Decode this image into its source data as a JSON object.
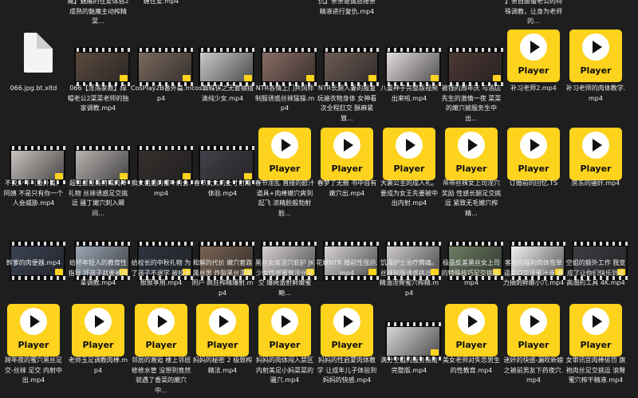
{
  "top_row": [
    {
      "col": 1,
      "label": "魔】魅魔的性爱体验2 成熟的魅魔主动榨精 菜..."
    },
    {
      "col": 2,
      "label": "缠性爱.mp4"
    },
    {
      "col": 5,
      "label": "仇】亲亲是诚恳接亲精液进行复仇.mp4"
    },
    {
      "col": 8,
      "label": "】亲自腰瘦老公的特殊调教，让身为老师的..."
    }
  ],
  "rows": [
    [
      {
        "type": "doc",
        "icon": "document-icon",
        "label": "066.jpg.bt.xltd"
      },
      {
        "type": "film",
        "color": "#5a4a3e",
        "label": "066【淫荡家教】绿帽老公2菜菜老师的独家调教.mp4"
      },
      {
        "type": "film",
        "color": "#7b6a5e",
        "label": "CosPlay2B番外篇.mp4"
      },
      {
        "type": "film",
        "color": "#c9c9c9",
        "label": "cos蜘蛛侠之无套抽插清纯少女.mp4"
      },
      {
        "type": "film",
        "color": "#8a6c64",
        "label": "NTR各情上门共饲师 制服诱惑丝袜猛操.mp4"
      },
      {
        "type": "film",
        "color": "#6d5b55",
        "label": "NTR长腿人妻的报复 玩遍衣物身体 女神看次全程肛交 酥麻紧致..."
      },
      {
        "type": "film",
        "color": "#e3dcdc",
        "label": "八重神子完整版视频出来啦.mp4"
      },
      {
        "type": "film",
        "color": "#4d3835",
        "label": "被钱的周年庆 与酒店先生的激情一夜 菜菜的嫩穴被服务生中出..."
      },
      {
        "type": "player",
        "label": "补习老师2.mp4"
      },
      {
        "type": "player",
        "label": "补习老师的肉体教学.mp4"
      }
    ],
    [
      {
        "type": "film",
        "color": "#c8c2bf",
        "label": "不良少年（番外篇）阿姨 不是只有你一个人会威胁.mp4"
      },
      {
        "type": "film",
        "color": "#b7b3b1",
        "label": "超性感淫荡特辑肉棒礼物 丝袜诱惑足交挑逗 骚丁嫩穴刺入瞬间..."
      },
      {
        "type": "film",
        "color": "#35302e",
        "label": "痴女姐姐的樱叶约会.mp4"
      },
      {
        "type": "film",
        "color": "#43404a",
        "label": "春节太太的止寸射精体验.mp4"
      },
      {
        "type": "player",
        "label": "春节淫乱 直接的慰汁 道具+肉棒嫩穴爽到起飞 浓精脸般勃射脸..."
      },
      {
        "type": "player",
        "label": "春梦了无痕 书中自有嫩穴出.mp4"
      },
      {
        "type": "player",
        "label": "大裹公主的成人礼。要成为女王先要被中出内射.mp4"
      },
      {
        "type": "player",
        "label": "吊带丝袜女上司淫穴奖励 性感长腿足交挑逗 紧致无毛嫩穴榨精..."
      },
      {
        "type": "player",
        "label": "订婚前的回忆.TS"
      },
      {
        "type": "player",
        "label": "房东的骚奸.mp4"
      }
    ],
    [
      {
        "type": "film",
        "color": "#3a4253",
        "label": "幹爹的肉便器.mp4"
      },
      {
        "type": "film",
        "color": "#9aa6b4",
        "label": "给坏年轻人的教育性指导 坏孩子就要被同辈调教.mp4"
      },
      {
        "type": "film",
        "color": "#2f3440",
        "label": "给校长的中秋礼物 为了孩子不退学 被校长狠狠享用.mp4"
      },
      {
        "type": "film",
        "color": "#7a6454",
        "label": "和解的代价 嫩穴套路属丝男 炸裂黑丝漂嫩阴户 疯狂榨精爆射.mp4"
      },
      {
        "type": "film",
        "color": "#d7d3d2",
        "label": "黑丝女高淫穴庇护 JK少女性感蜜臀淫丝足交 爆肏激射鲜嫩蜜鲍..."
      },
      {
        "type": "film",
        "color": "#d8d4d4",
        "label": "花嫁NTR 婚前性强迫.mp4"
      },
      {
        "type": "film",
        "color": "#cdc9ca",
        "label": "饥渴护士治疗腾痛。丝袜制服诱惑挑逗，精油淫臀蜜穴榨精.mp4"
      },
      {
        "type": "film",
        "color": "#6d7e63",
        "label": "极品反差黑丝女上司的特殊技巧足交挑逗.mp4"
      },
      {
        "type": "film",
        "color": "#f2f2f2",
        "label": "客服的福利肉体签单 逼柔口交淫蜜汁液 暴力抽刺鲜嫩小穴.mp4"
      },
      {
        "type": "film",
        "color": "#3e3e44",
        "label": "空姐的额外工作 我变成了让你们快乐到达高潮的工具 4K.mp4"
      }
    ],
    [
      {
        "type": "player",
        "label": "跨年夜的蜜穴黑丝足交-丝袜 足交 内射中出.mp4"
      },
      {
        "type": "player",
        "label": "老师玉足调教肉棒.mp4"
      },
      {
        "type": "player",
        "label": "邻居的邂逅 楼上邻居修修水管 没想到竟然就遇了香菜的嫩穴 中..."
      },
      {
        "type": "player",
        "label": "妈妈的秘密 2 极致榨精法.mp4"
      },
      {
        "type": "player",
        "label": "妈妈的肉体闯入禁区内射美足小妈菜菜的骚穴.mp4"
      },
      {
        "type": "player",
        "label": "妈妈的性启蒙肉体教学 让成年儿子体验到妈妈的快感.mp4"
      },
      {
        "type": "film",
        "color": "#d9d6d6",
        "label": "满分空姐的服务指南完整版.mp4"
      },
      {
        "type": "player",
        "label": "美女老师对失恋男生的性教育.mp4"
      },
      {
        "type": "player",
        "label": "迷奸的快感-漏吹新娘之被前男友下药夜穴.mp4"
      },
      {
        "type": "player",
        "label": "女审讯官肉棒惩罚 旗袍肉丝足交挑逗 浪臀蜜穴榨干精液.mp4"
      }
    ]
  ]
}
